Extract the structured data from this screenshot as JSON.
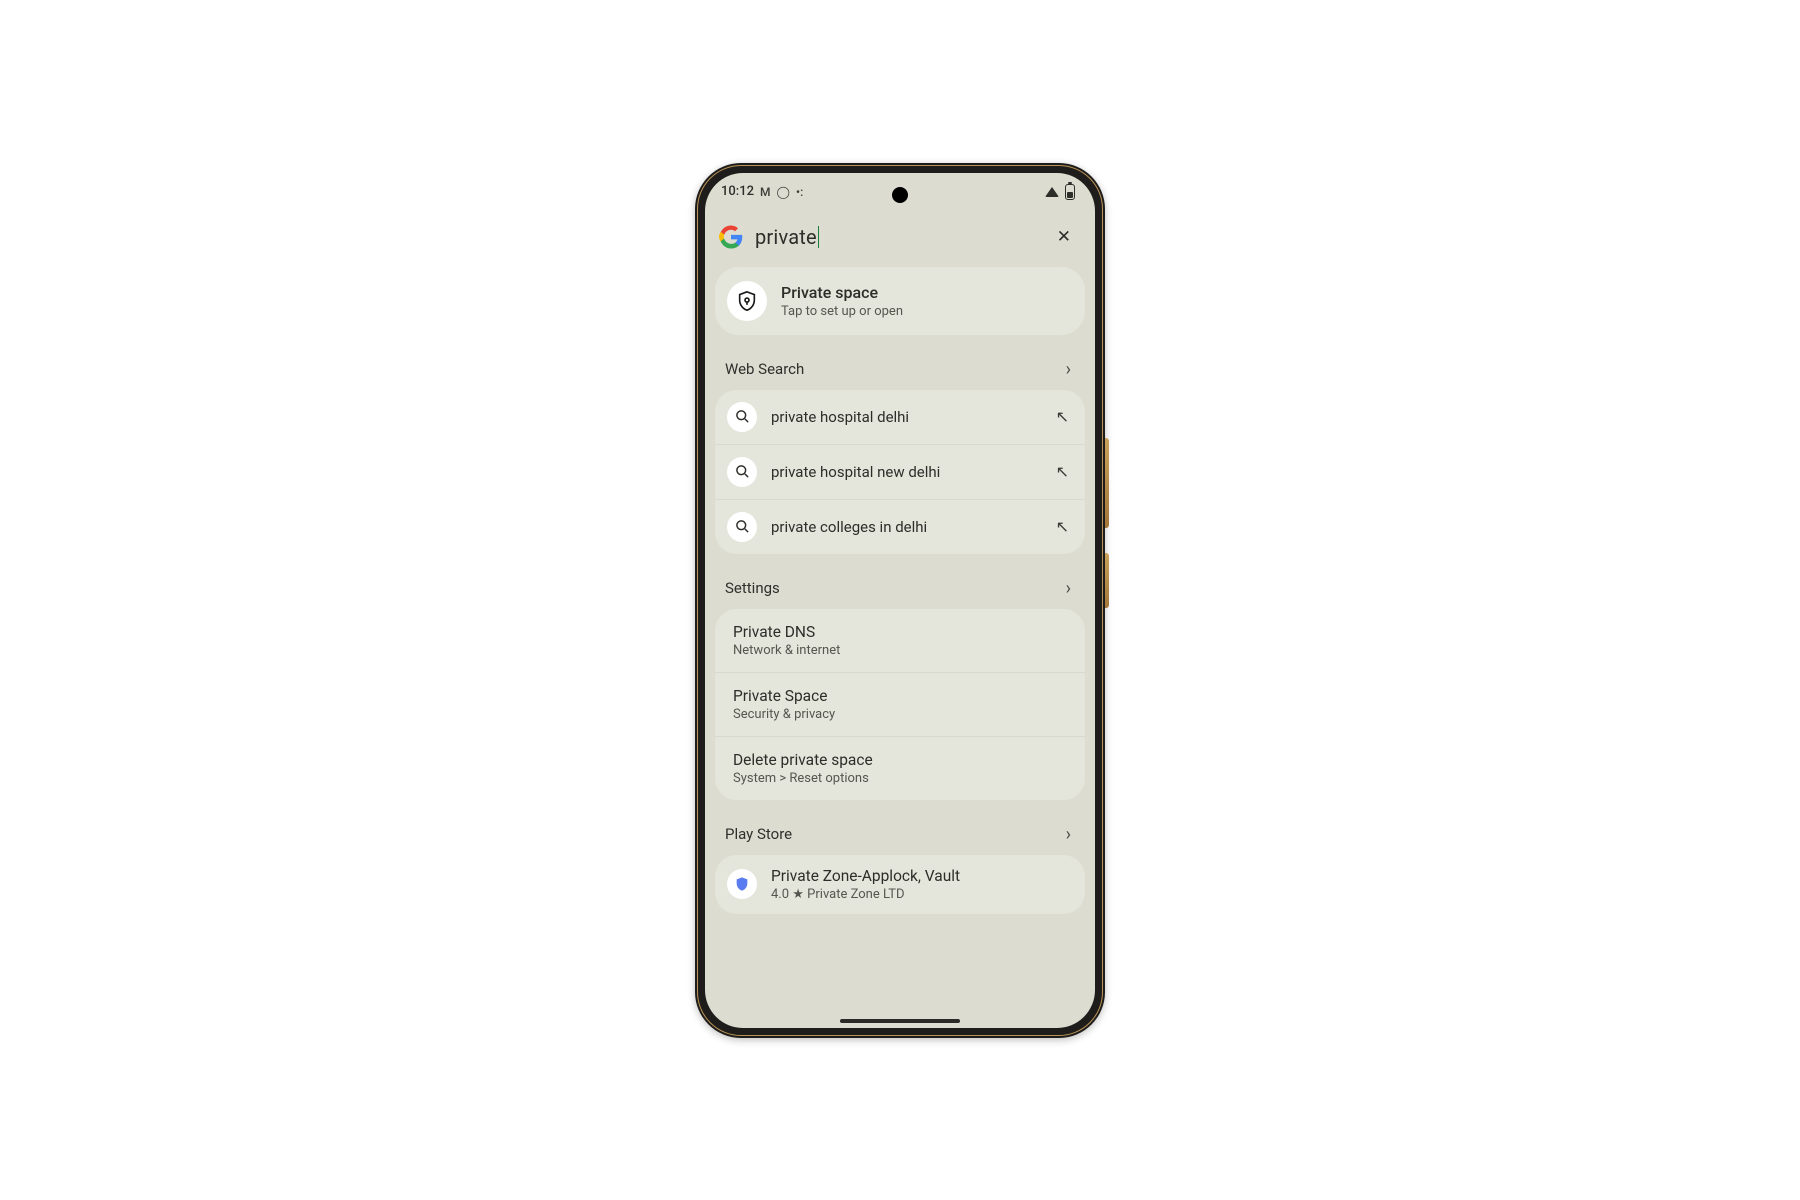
{
  "statusbar": {
    "time": "10:12"
  },
  "search": {
    "query": "private"
  },
  "feature": {
    "title": "Private space",
    "subtitle": "Tap to set up or open"
  },
  "web": {
    "header": "Web Search",
    "suggestions": [
      {
        "text": "private hospital delhi"
      },
      {
        "text": "private hospital new delhi"
      },
      {
        "text": "private colleges in delhi"
      }
    ]
  },
  "settings": {
    "header": "Settings",
    "items": [
      {
        "title": "Private DNS",
        "subtitle": "Network & internet"
      },
      {
        "title": "Private Space",
        "subtitle": "Security & privacy"
      },
      {
        "title": "Delete private space",
        "subtitle": "System > Reset options"
      }
    ]
  },
  "play": {
    "header": "Play Store",
    "item": {
      "title": "Private Zone-Applock, Vault",
      "rating": "4.0",
      "star": "★",
      "dev": "Private Zone LTD"
    }
  }
}
